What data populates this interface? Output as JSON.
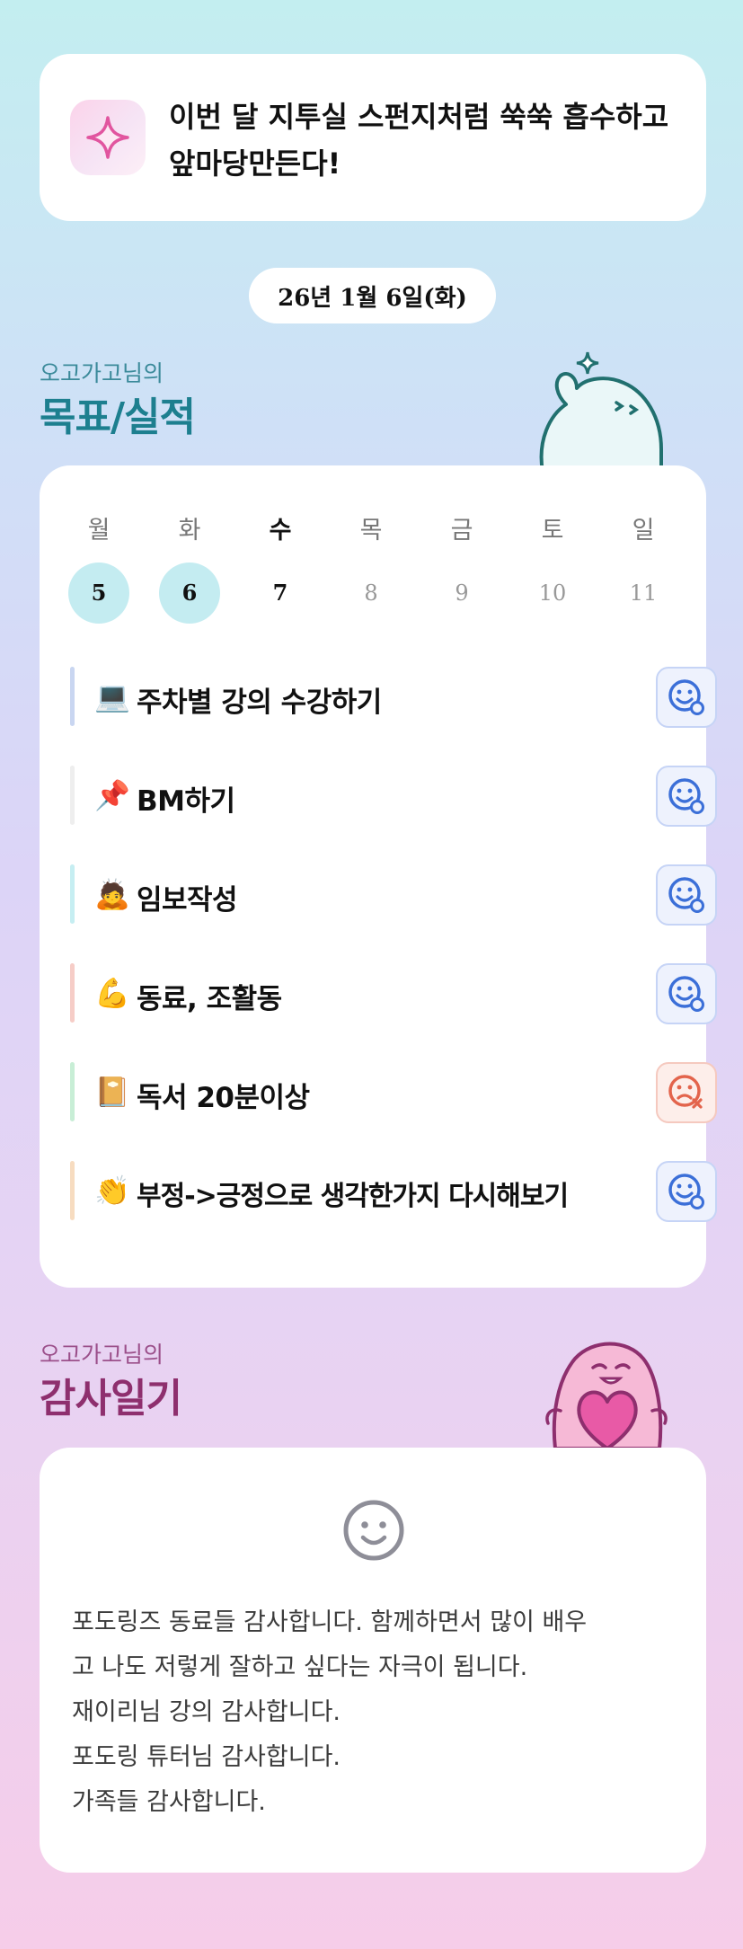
{
  "motto": {
    "icon": "sparkle-icon",
    "line1": "이번 달 지투실 스펀지처럼 쑥쑥 흡수하고",
    "line2": "앞마당만든다!"
  },
  "date": "26년 1월 6일(화)",
  "goals_section": {
    "subtitle": "오고가고님의",
    "title": "목표/실적",
    "subtitle_color": "#3b8a9a",
    "title_color": "#1d7f8f"
  },
  "week": {
    "days": [
      {
        "name": "월",
        "num": "5",
        "state": "done"
      },
      {
        "name": "화",
        "num": "6",
        "state": "done"
      },
      {
        "name": "수",
        "num": "7",
        "state": "today"
      },
      {
        "name": "목",
        "num": "8",
        "state": "future"
      },
      {
        "name": "금",
        "num": "9",
        "state": "future"
      },
      {
        "name": "토",
        "num": "10",
        "state": "future"
      },
      {
        "name": "일",
        "num": "11",
        "state": "future"
      }
    ]
  },
  "goals": [
    {
      "emoji": "💻",
      "label": "주차별 강의 수강하기",
      "bar_color": "#c9d6f1",
      "status": "ok"
    },
    {
      "emoji": "📌",
      "label": "BM하기",
      "bar_color": "#eeeeee",
      "status": "ok"
    },
    {
      "emoji": "🙇",
      "label": "임보작성",
      "bar_color": "#c6eef2",
      "status": "ok"
    },
    {
      "emoji": "💪",
      "label": "동료, 조활동",
      "bar_color": "#f6cdc7",
      "status": "ok"
    },
    {
      "emoji": "📔",
      "label": "독서 20분이상",
      "bar_color": "#c8eed6",
      "status": "fail"
    },
    {
      "emoji": "👏",
      "label": "부정->긍정으로 생각한가지 다시해보기",
      "bar_color": "#f7dcc0",
      "status": "ok"
    }
  ],
  "gratitude_section": {
    "subtitle": "오고가고님의",
    "title": "감사일기",
    "subtitle_color": "#9b4f8a",
    "title_color": "#8e2f6e"
  },
  "gratitude": {
    "face_icon": "smile-face-icon",
    "lines": [
      "포도링즈 동료들 감사합니다. 함께하면서 많이 배우",
      "고 나도 저렇게 잘하고 싶다는 자극이 됩니다.",
      "재이리님 강의 감사합니다.",
      "포도링 튜터님 감사합니다.",
      "가족들 감사합니다."
    ]
  },
  "colors": {
    "status_ok": "#3b6fd8",
    "status_fail": "#e3644c",
    "done_day_bg": "#c4ecf1"
  }
}
